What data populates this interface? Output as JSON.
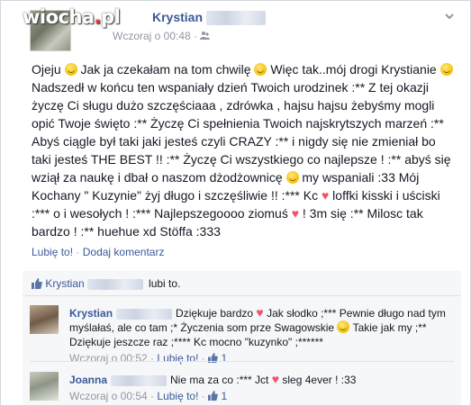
{
  "watermark": {
    "brand": "wiocha",
    "dot": ".",
    "tld": "pl"
  },
  "post": {
    "author": "Krystian",
    "timestamp": "Wczoraj o 00:48",
    "separator": "·",
    "body": [
      {
        "t": "text",
        "v": "Ojeju "
      },
      {
        "t": "emoji",
        "v": "smile"
      },
      {
        "t": "text",
        "v": " Jak ja czekałam na tom chwilę "
      },
      {
        "t": "emoji",
        "v": "smile"
      },
      {
        "t": "text",
        "v": " Więc tak..mój drogi Krystianie "
      },
      {
        "t": "emoji",
        "v": "smile"
      },
      {
        "t": "text",
        "v": " Nadszedł w końcu ten wspaniały dzień Twoich urodzinek :** Z tej okazji życzę Ci sługu dużo szczęściaaa , zdrówka , hajsu hajsu żebyśmy mogli opić Twoje święto :** Życzę Ci spełnienia Twoich najskrytszych marzeń :** Abyś ciągle był taki jaki jesteś czyli CRAZY :** i nigdy się nie zmieniał bo taki jesteś THE BEST !! :** Życzę Ci wszystkiego co najlepsze ! :** abyś się wziął za naukę i dbał o naszom dżodżownicę "
      },
      {
        "t": "emoji",
        "v": "smile"
      },
      {
        "t": "text",
        "v": " my wspaniali :33 Mój Kochany \" Kuzynie\" żyj długo i szczęśliwie !! :*** Kc "
      },
      {
        "t": "heart",
        "v": "♥"
      },
      {
        "t": "text",
        "v": " loffki kisski i uściski :*** o i wesołych ! :*** Najlepszegoooo ziomuś "
      },
      {
        "t": "heart",
        "v": "♥"
      },
      {
        "t": "text",
        "v": " ! 3m się :** Milosc tak bardzo ! :** huehue xd Stöffa :333"
      }
    ],
    "actions": {
      "like": "Lubię to!",
      "sep": "·",
      "comment": "Dodaj komentarz"
    }
  },
  "likes": {
    "name": "Krystian",
    "suffix": "lubi to.",
    "thumb_icon": "thumbs-up-icon"
  },
  "comments": [
    {
      "author": "Krystian",
      "segments": [
        {
          "t": "text",
          "v": "Dziękuje bardzo "
        },
        {
          "t": "heart",
          "v": "♥"
        },
        {
          "t": "text",
          "v": " Jak słodko ;*** Pewnie długo nad tym myślałaś, ale co tam ;* Życzenia som prze Swagowskie "
        },
        {
          "t": "emoji",
          "v": "smile"
        },
        {
          "t": "text",
          "v": " Takie jak my ;** Dziękuje jeszcze raz ;**** Kc mocno \"kuzynko\" ;******"
        }
      ],
      "time": "Wczoraj o 00:52",
      "like": "Lubię to!",
      "like_count": "1"
    },
    {
      "author": "Joanna",
      "segments": [
        {
          "t": "text",
          "v": "Nie ma za co :*** Jct "
        },
        {
          "t": "heart",
          "v": "♥"
        },
        {
          "t": "text",
          "v": " sleg 4ever ! :33"
        }
      ],
      "time": "Wczoraj o 00:54",
      "like": "Lubię to!",
      "like_count": "1"
    }
  ],
  "colors": {
    "link": "#3b5998",
    "meta": "#9197a3",
    "heart": "#f25268",
    "background": "#e9ebee"
  }
}
